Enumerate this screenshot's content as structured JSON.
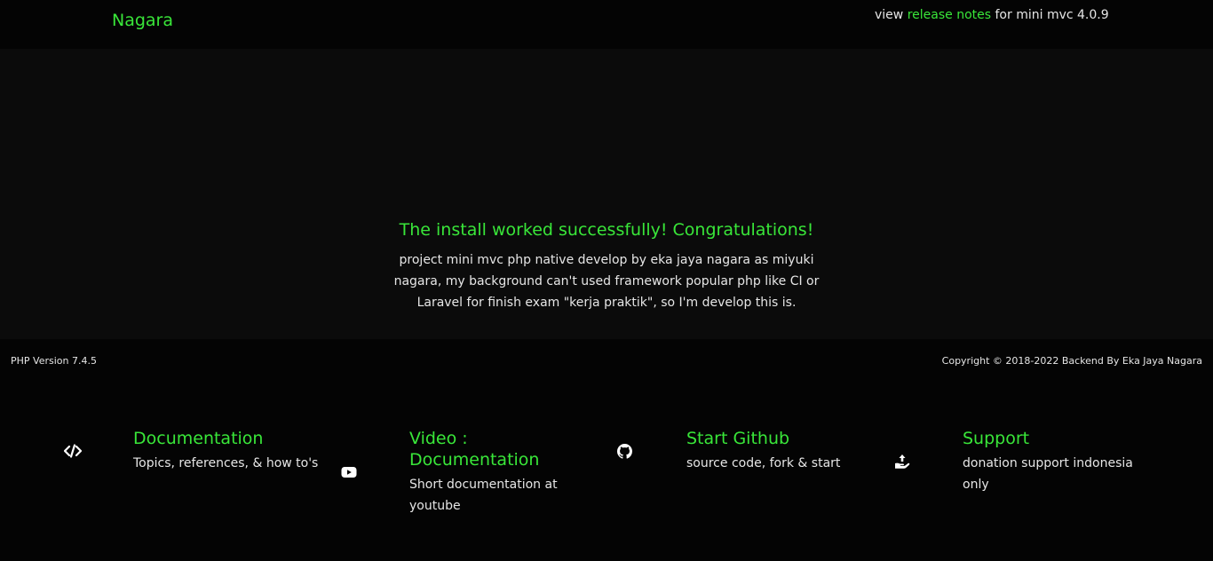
{
  "header": {
    "brand": "Nagara",
    "release_prefix": "view ",
    "release_link": "release notes",
    "release_suffix": " for mini mvc 4.0.9"
  },
  "hero": {
    "title": "The install worked successfully! Congratulations!",
    "description": "project mini mvc php native develop by eka jaya nagara as miyuki nagara, my background can't used framework popular php like CI or Laravel for finish exam \"kerja praktik\", so I'm develop this is."
  },
  "info": {
    "php_version": "PHP Version 7.4.5",
    "copyright": "Copyright © 2018-2022 Backend By Eka Jaya Nagara"
  },
  "features": [
    {
      "icon": "code-icon",
      "title": "Documentation",
      "desc": "Topics, references, & how to's"
    },
    {
      "icon": "youtube-icon",
      "title": "Video : Documentation",
      "desc": "Short documentation at youtube"
    },
    {
      "icon": "github-icon",
      "title": "Start Github",
      "desc": "source code, fork & start"
    },
    {
      "icon": "donate-icon",
      "title": "Support",
      "desc": "donation support indonesia only"
    }
  ],
  "colors": {
    "accent": "#39e639",
    "background": "#040404",
    "hero_background": "#0b0b0b",
    "text": "#e6e6e6"
  }
}
